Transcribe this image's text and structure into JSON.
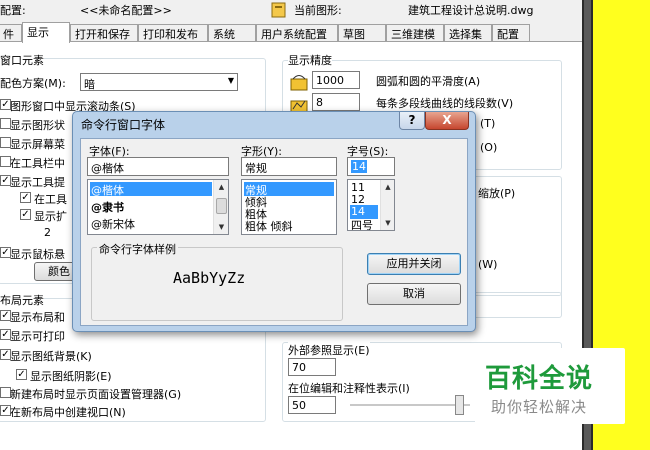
{
  "header": {
    "profile_label": "配置:",
    "profile_value": "<<未命名配置>>",
    "current_drawing_label": "当前图形:",
    "current_drawing_value": "建筑工程设计总说明.dwg"
  },
  "tabs": [
    "件",
    "显示",
    "打开和保存",
    "打印和发布",
    "系统",
    "用户系统配置",
    "草图",
    "三维建模",
    "选择集",
    "配置"
  ],
  "active_tab": "显示",
  "window_elements": {
    "title": "窗口元素",
    "color_scheme_label": "配色方案(M):",
    "color_scheme_value": "暗",
    "checkboxes": [
      {
        "label": "图形窗口中显示滚动条(S)",
        "checked": true
      },
      {
        "label": "显示图形状",
        "checked": false
      },
      {
        "label": "显示屏幕菜",
        "checked": false
      },
      {
        "label": "在工具栏中",
        "checked": false
      },
      {
        "label": "显示工具提",
        "checked": true
      },
      {
        "label": "在工具",
        "checked": true
      },
      {
        "label": "显示扩",
        "checked": true
      }
    ],
    "delay_value": "2",
    "mouse_hover_label": "显示鼠标悬",
    "colors_button": "颜色"
  },
  "layout_elements": {
    "title": "布局元素",
    "checkboxes": [
      {
        "label": "显示布局和",
        "checked": true
      },
      {
        "label": "显示可打印",
        "checked": true
      },
      {
        "label": "显示图纸背景(K)",
        "checked": true
      },
      {
        "label": "显示图纸阴影(E)",
        "checked": true
      },
      {
        "label": "新建布局时显示页面设置管理器(G)",
        "checked": false
      },
      {
        "label": "在新布局中创建视口(N)",
        "checked": true
      }
    ]
  },
  "display_resolution": {
    "title": "显示精度",
    "rows": [
      {
        "value": "1000",
        "label": "圆弧和圆的平滑度(A)"
      },
      {
        "value": "8",
        "label": "每条多段线曲线的线段数(V)"
      }
    ],
    "partial_labels": [
      "(T)",
      "(O)",
      "缩放(P)",
      "(W)"
    ]
  },
  "xref": {
    "xref_label": "外部参照显示(E)",
    "xref_value": "70",
    "inplace_label": "在位编辑和注释性表示(I)",
    "inplace_value": "50"
  },
  "dialog": {
    "title": "命令行窗口字体",
    "help_glyph": "?",
    "close_glyph": "X",
    "font_label": "字体(F):",
    "font_value": "@楷体",
    "font_items": [
      "@楷体",
      "@隶书",
      "@新宋体"
    ],
    "style_label": "字形(Y):",
    "style_value": "常规",
    "style_items": [
      "常规",
      "倾斜",
      "粗体",
      "粗体 倾斜"
    ],
    "size_label": "字号(S):",
    "size_value": "14",
    "size_items": [
      "11",
      "12",
      "14",
      "四号"
    ],
    "sample_label": "命令行字体样例",
    "sample_text": "AaBbYyZz",
    "apply_button": "应用并关闭",
    "cancel_button": "取消"
  },
  "watermark": {
    "title": "百科全说",
    "subtitle": "助你轻松解决"
  },
  "colors": {
    "selection": "#3399ff",
    "dialog_frame": "#b9d1ea",
    "close_red": "#c6462f",
    "watermark_green": "#1e9a3b",
    "side_yellow": "#ffff1e"
  }
}
